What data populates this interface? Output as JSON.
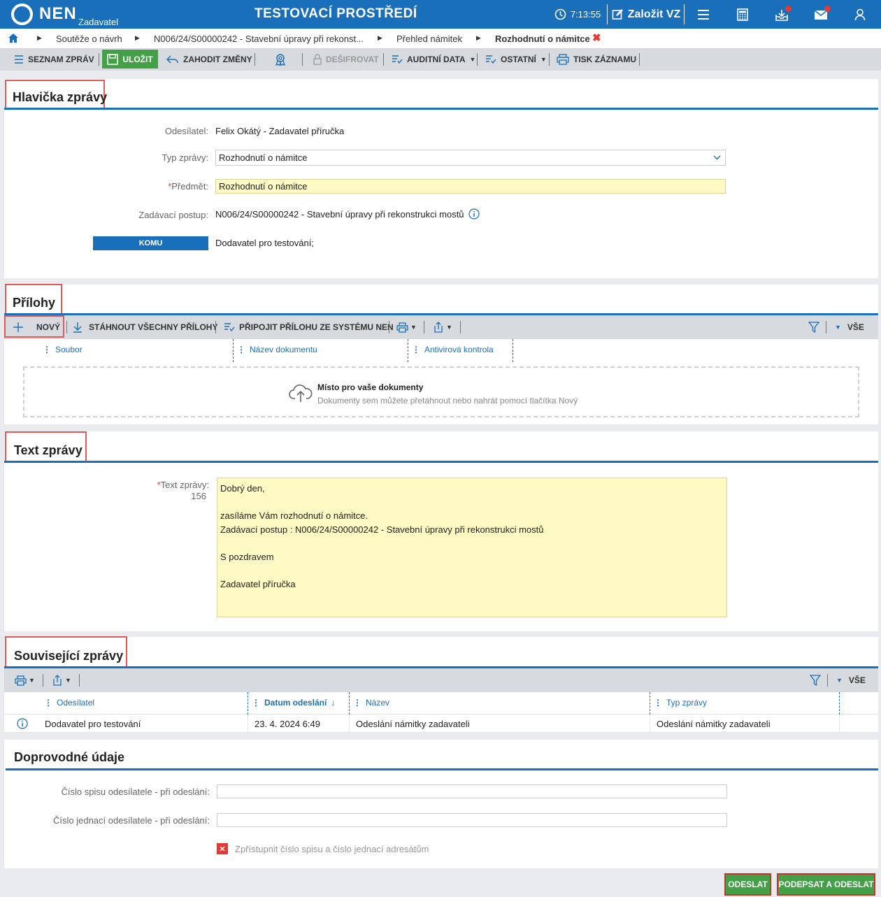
{
  "header": {
    "logo": "NEN",
    "logo_sub": "Zadavatel",
    "environment": "TESTOVACÍ PROSTŘEDÍ",
    "time": "7:13:55",
    "create_label": "Založit VZ"
  },
  "breadcrumb": [
    "Soutěže o návrh",
    "N006/24/S00000242 - Stavební úpravy při rekonst...",
    "Přehled námitek",
    "Rozhodnutí o námitce"
  ],
  "toolbar": {
    "list": "SEZNAM ZPRÁV",
    "save": "ULOŽIT",
    "discard": "ZAHODIT ZMĚNY",
    "decrypt": "DEŠIFROVAT",
    "audit": "AUDITNÍ DATA",
    "other": "OSTATNÍ",
    "print": "TISK ZÁZNAMU"
  },
  "head": {
    "title": "Hlavička zprávy",
    "sender_label": "Odesílatel:",
    "sender": "Felix Okátý - Zadavatel příručka",
    "type_label": "Typ zprávy:",
    "type": "Rozhodnutí o námitce",
    "subject_label": "Předmět:",
    "subject": "Rozhodnutí o námitce",
    "procedure_label": "Zadávací postup:",
    "procedure": "N006/24/S00000242 - Stavební úpravy při rekonstrukci mostů",
    "to_button": "KOMU",
    "to": "Dodavatel pro testování;"
  },
  "attachments": {
    "title": "Přílohy",
    "new": "NOVÝ",
    "download_all": "STÁHNOUT VŠECHNY PŘÍLOHY",
    "attach_system": "PŘIPOJIT PŘÍLOHU ZE SYSTÉMU NEN",
    "all": "VŠE",
    "columns": [
      "Soubor",
      "Název dokumentu",
      "Antivirová kontrola"
    ],
    "drop_title": "Místo pro vaše dokumenty",
    "drop_hint": "Dokumenty sem můžete přetáhnout nebo nahrát pomocí tlačítka Nový"
  },
  "message": {
    "title": "Text zprávy",
    "label": "Text zprávy:",
    "count": "156",
    "lines": [
      "Dobrý den,",
      "",
      "zasíláme Vám rozhodnutí o námitce.",
      "Zadávací postup : N006/24/S00000242 - Stavební úpravy při rekonstrukci mostů",
      "",
      "S pozdravem",
      "",
      "Zadavatel příručka"
    ]
  },
  "related": {
    "title": "Související zprávy",
    "all": "VŠE",
    "columns": [
      "Odesílatel",
      "Datum odeslání",
      "Název",
      "Typ zprávy"
    ],
    "rows": [
      {
        "sender": "Dodavatel pro testování",
        "date": "23. 4. 2024 6:49",
        "name": "Odeslání námitky zadavateli",
        "type": "Odeslání námitky zadavateli"
      }
    ]
  },
  "extra": {
    "title": "Doprovodné údaje",
    "file_label": "Číslo spisu odesílatele - při odeslání:",
    "ref_label": "Číslo jednací odesílatele - při odeslání:",
    "share_label": "Zpřístupnit číslo spisu a číslo jednací adresátům"
  },
  "footer": {
    "send": "ODESLAT",
    "sign_send": "PODEPSAT A ODESLAT"
  },
  "colors": {
    "primary": "#1a6fba",
    "green": "#43a047",
    "highlight": "#e05a5a"
  }
}
